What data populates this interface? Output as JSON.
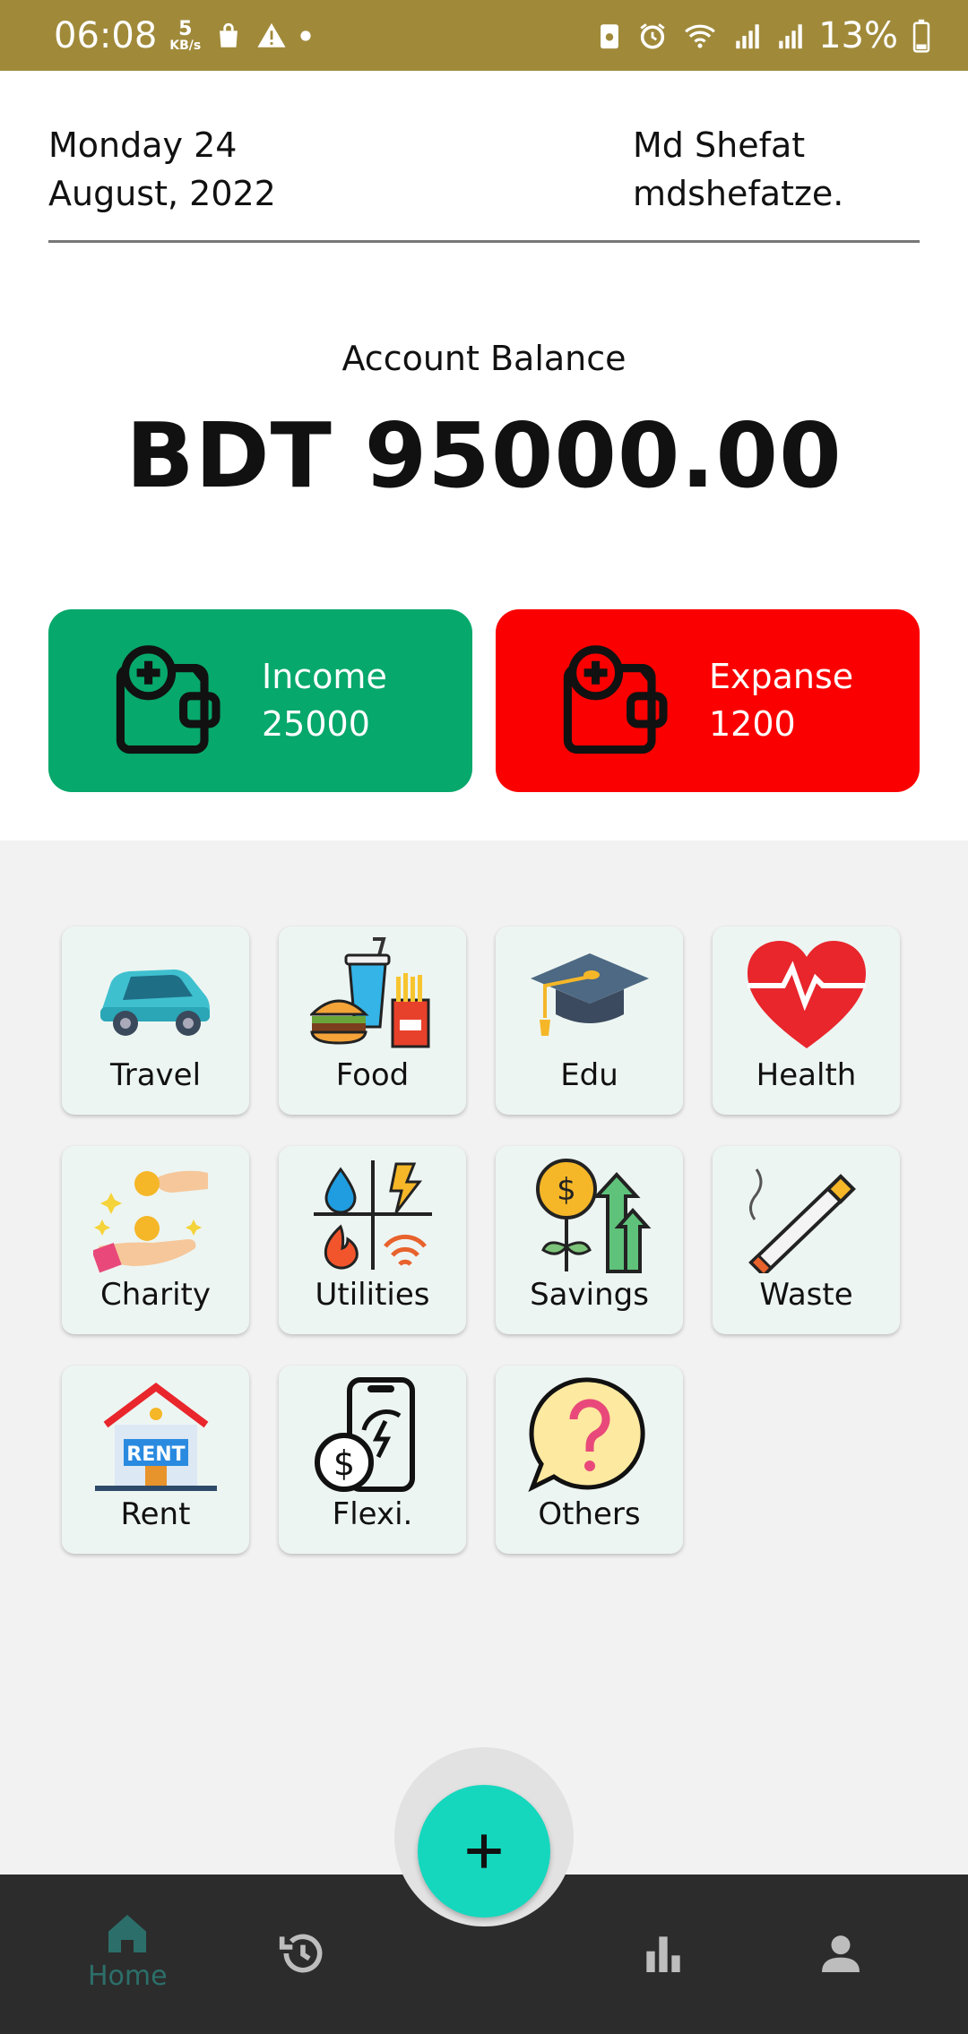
{
  "status_bar": {
    "time": "06:08",
    "speed_value": "5",
    "speed_unit": "KB/s",
    "battery": "13%"
  },
  "header": {
    "date_line1": "Monday 24",
    "date_line2": "August, 2022",
    "user_name": "Md Shefat",
    "user_handle": "mdshefatze."
  },
  "balance": {
    "label": "Account Balance",
    "amount": "BDT 95000.00"
  },
  "cards": {
    "income": {
      "label": "Income",
      "value": "25000",
      "color": "#07a86b"
    },
    "expense": {
      "label": "Expanse",
      "value": "1200",
      "color": "#fb0000"
    }
  },
  "categories": [
    {
      "label": "Travel",
      "icon": "car-icon"
    },
    {
      "label": "Food",
      "icon": "fast-food-icon"
    },
    {
      "label": "Edu",
      "icon": "graduation-cap-icon"
    },
    {
      "label": "Health",
      "icon": "heart-pulse-icon"
    },
    {
      "label": "Charity",
      "icon": "charity-hands-icon"
    },
    {
      "label": "Utilities",
      "icon": "utilities-icon"
    },
    {
      "label": "Savings",
      "icon": "savings-growth-icon"
    },
    {
      "label": "Waste",
      "icon": "cigarette-icon"
    },
    {
      "label": "Rent",
      "icon": "rent-house-icon"
    },
    {
      "label": "Flexi.",
      "icon": "mobile-recharge-icon"
    },
    {
      "label": "Others",
      "icon": "question-bubble-icon"
    }
  ],
  "bottom_nav": {
    "home_label": "Home",
    "items": [
      "home-icon",
      "history-icon",
      "add-icon",
      "bar-chart-icon",
      "profile-icon"
    ]
  },
  "colors": {
    "status_bar": "#a08a3a",
    "fab": "#14d7be",
    "nav_bar": "#2c2c2c",
    "nav_active": "#2c6f6a"
  }
}
